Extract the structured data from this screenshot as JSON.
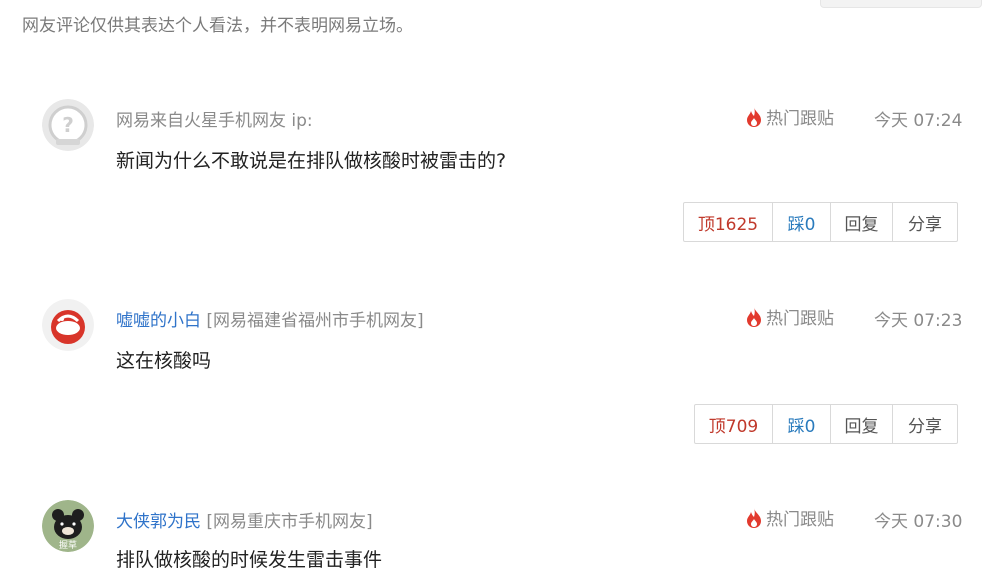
{
  "disclaimer": "网友评论仅供其表达个人看法，并不表明网易立场。",
  "comments": [
    {
      "user": "网易来自火星手机网友",
      "ip_text": " ip:",
      "location": "",
      "hot_label": "热门跟贴",
      "time": "今天 07:24",
      "content": "新闻为什么不敢说是在排队做核酸时被雷击的?",
      "up": "顶1625",
      "down": "踩0",
      "reply": "回复",
      "share": "分享"
    },
    {
      "user": "嘘嘘的小白",
      "location": "[网易福建省福州市手机网友]",
      "hot_label": "热门跟贴",
      "time": "今天 07:23",
      "content": "这在核酸吗",
      "up": "顶709",
      "down": "踩0",
      "reply": "回复",
      "share": "分享"
    },
    {
      "user": "大侠郭为民",
      "location": "[网易重庆市手机网友]",
      "avatar_text": "握草",
      "hot_label": "热门跟贴",
      "time": "今天 07:30",
      "content": "排队做核酸的时候发生雷击事件"
    }
  ],
  "colors": {
    "link": "#2f73c9",
    "up": "#c0392b",
    "down": "#2a7bbd",
    "hot_flame": "#e23a2e"
  }
}
